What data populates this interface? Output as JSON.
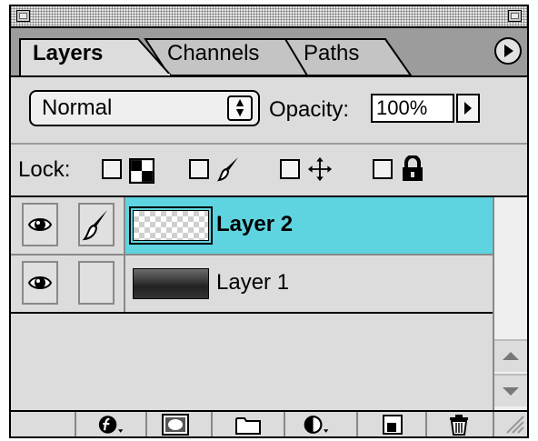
{
  "window": {
    "close_box_icon": "close-box-icon",
    "zoom_box_icon": "collapse-box-icon"
  },
  "tabs": [
    {
      "label": "Layers",
      "active": true
    },
    {
      "label": "Channels",
      "active": false
    },
    {
      "label": "Paths",
      "active": false
    }
  ],
  "palette_menu_icon": "palette-menu-arrow-icon",
  "blend": {
    "mode_value": "Normal",
    "opacity_label": "Opacity:",
    "opacity_value": "100%"
  },
  "lock": {
    "label": "Lock:",
    "options": [
      {
        "icon": "transparency-lock-icon",
        "checked": false
      },
      {
        "icon": "brush-lock-icon",
        "checked": false
      },
      {
        "icon": "move-lock-icon",
        "checked": false
      },
      {
        "icon": "padlock-icon",
        "checked": false
      }
    ]
  },
  "layers": [
    {
      "name": "Layer 2",
      "selected": true,
      "visible": true,
      "thumbnail": "transparent-checkerboard",
      "brush_active": true
    },
    {
      "name": "Layer 1",
      "selected": false,
      "visible": true,
      "thumbnail": "dark-gradient",
      "brush_active": false
    }
  ],
  "bottom_toolbar": [
    {
      "icon": "layer-effects-icon"
    },
    {
      "icon": "layer-mask-icon"
    },
    {
      "icon": "new-layer-set-icon"
    },
    {
      "icon": "adjustment-layer-icon"
    },
    {
      "icon": "new-layer-icon"
    },
    {
      "icon": "trash-icon"
    }
  ],
  "colors": {
    "selection": "#5ed4e0",
    "panel": "#dcdcdc",
    "tab_bar": "#9c9c9c"
  }
}
